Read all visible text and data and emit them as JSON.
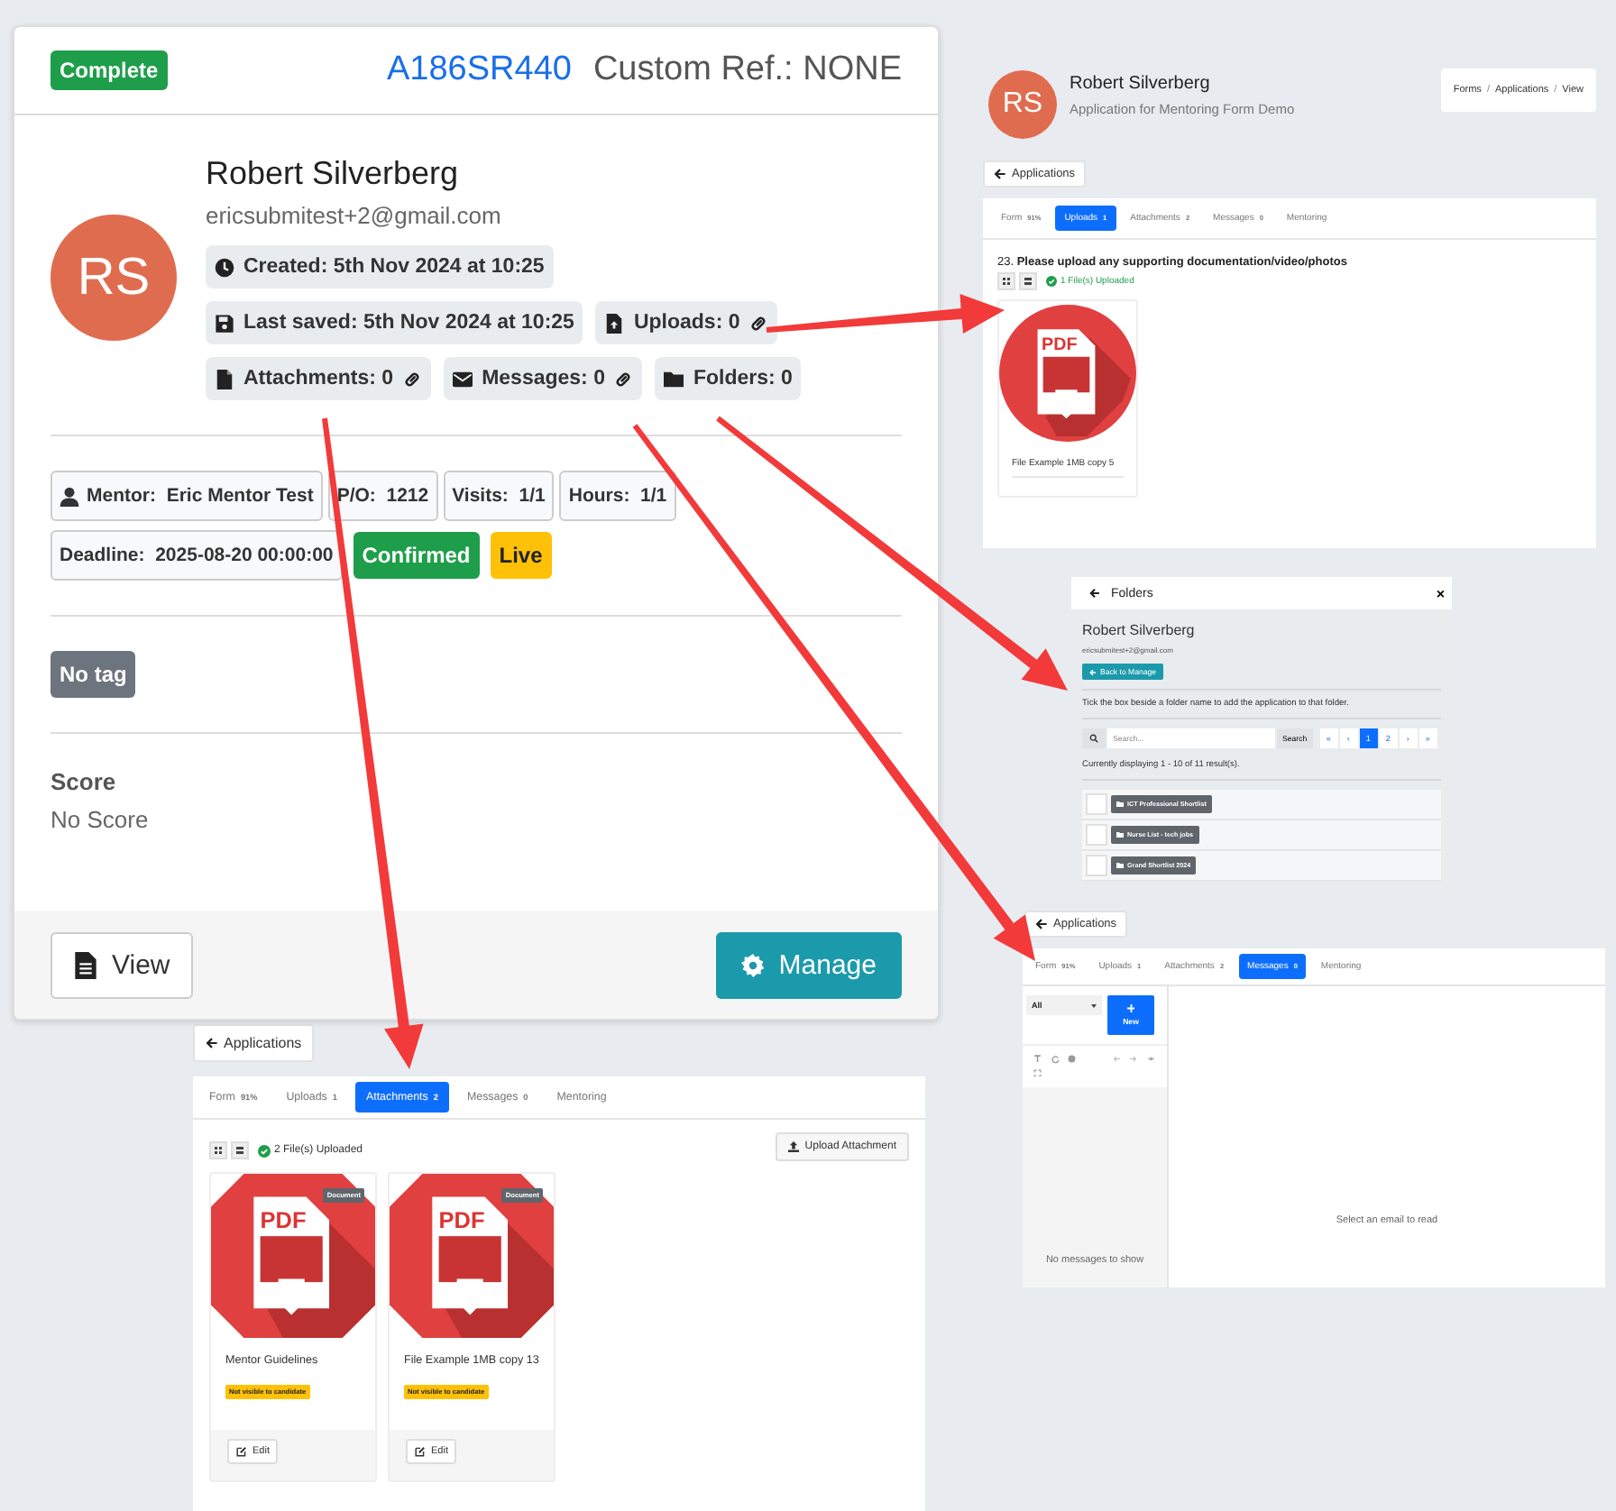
{
  "main_card": {
    "status_badge": "Complete",
    "reference": "A186SR440",
    "custom_ref": "Custom Ref.: NONE",
    "avatar_initials": "RS",
    "name": "Robert Silverberg",
    "email": "ericsubmitest+2@gmail.com",
    "info_rows": [
      {
        "chips": [
          {
            "kind": "created",
            "label": "Created: 5th Nov 2024 at 10:25",
            "link": false
          }
        ]
      },
      {
        "chips": [
          {
            "kind": "saved",
            "label": "Last saved: 5th Nov 2024 at 10:25",
            "link": false
          },
          {
            "kind": "uploads",
            "label": "Uploads: 0",
            "link": true
          }
        ]
      },
      {
        "chips": [
          {
            "kind": "attachments",
            "label": "Attachments: 0",
            "link": true
          },
          {
            "kind": "messages",
            "label": "Messages: 0",
            "link": true
          },
          {
            "kind": "folders",
            "label": "Folders: 0",
            "link": false
          }
        ]
      }
    ],
    "detail_rows": [
      {
        "items": [
          {
            "kind": "mentor",
            "label": "Mentor:",
            "value": "Eric Mentor Test"
          },
          {
            "kind": "field",
            "label": "P/O:",
            "value": "1212"
          },
          {
            "kind": "field",
            "label": "Visits:",
            "value": "1/1"
          },
          {
            "kind": "field",
            "label": "Hours:",
            "value": "1/1"
          }
        ]
      },
      {
        "items": [
          {
            "kind": "field",
            "label": "Deadline:",
            "value": "2025-08-20 00:00:00"
          },
          {
            "kind": "status",
            "label": "Confirmed",
            "color": "#1e9e4a"
          },
          {
            "kind": "status",
            "label": "Live",
            "color": "#ffc107"
          }
        ]
      }
    ],
    "tag": "No tag",
    "score_label": "Score",
    "score_value": "No Score",
    "actions": [
      {
        "kind": "view",
        "label": "View"
      },
      {
        "kind": "manage",
        "label": "Manage"
      }
    ]
  },
  "uploads_view": {
    "avatar_initials": "RS",
    "name": "Robert Silverberg",
    "subtitle": "Application for Mentoring Form Demo",
    "breadcrumb": [
      "Forms",
      "Applications",
      "View"
    ],
    "breadcrumb_separator": "/",
    "back_button": "Applications",
    "tabs": [
      {
        "label": "Form",
        "count": "91%",
        "selected": false
      },
      {
        "label": "Uploads",
        "count": "1",
        "selected": true
      },
      {
        "label": "Attachments",
        "count": "2",
        "selected": false
      },
      {
        "label": "Messages",
        "count": "0",
        "selected": false
      },
      {
        "label": "Mentoring",
        "selected": false
      }
    ],
    "question": "23. **Please upload any supporting documentation/video/photos**",
    "uploaded_count": "1 File(s) Uploaded",
    "files": [
      {
        "name": "File Example 1MB copy 5",
        "icon_label": "PDF"
      }
    ]
  },
  "folders_modal": {
    "title": "Folders",
    "close": "×",
    "name": "Robert Silverberg",
    "email": "ericsubmitest+2@gmail.com",
    "back_button": "Back to Manage",
    "instruction": "Tick the box beside a folder name to add the application to that folder.",
    "search": {
      "placeholder": "Search...",
      "button": "Search"
    },
    "pages": [
      {
        "label": "«",
        "selected": false
      },
      {
        "label": "‹",
        "selected": false
      },
      {
        "label": "1",
        "selected": true
      },
      {
        "label": "2",
        "selected": false
      },
      {
        "label": "›",
        "selected": false
      },
      {
        "label": "»",
        "selected": false
      }
    ],
    "result_summary": "Currently displaying 1 - 10 of 11 result(s).",
    "folders": [
      {
        "name": "ICT Professional Shortlist",
        "checked": false
      },
      {
        "name": "Nurse List - tech jobs",
        "checked": false
      },
      {
        "name": "Grand Shortlist 2024",
        "checked": false
      }
    ]
  },
  "messages_view": {
    "back_button": "Applications",
    "tabs": [
      {
        "label": "Form",
        "count": "91%",
        "selected": false
      },
      {
        "label": "Uploads",
        "count": "1",
        "selected": false
      },
      {
        "label": "Attachments",
        "count": "2",
        "selected": false
      },
      {
        "label": "Messages",
        "count": "0",
        "selected": true
      },
      {
        "label": "Mentoring",
        "selected": false
      }
    ],
    "filter": "All",
    "new_button": "New",
    "empty_list": "No messages to show",
    "empty_reader": "Select an email to read"
  },
  "attachments_view": {
    "back_button": "Applications",
    "tabs": [
      {
        "label": "Form",
        "count": "91%",
        "selected": false
      },
      {
        "label": "Uploads",
        "count": "1",
        "selected": false
      },
      {
        "label": "Attachments",
        "count": "2",
        "selected": true
      },
      {
        "label": "Messages",
        "count": "0",
        "selected": false
      },
      {
        "label": "Mentoring",
        "selected": false
      }
    ],
    "uploaded_count": "2 File(s) Uploaded",
    "upload_button": "Upload Attachment",
    "files": [
      {
        "name": "Mentor Guidelines",
        "icon_label": "PDF",
        "type_badge": "Document",
        "visibility": "Not visible to candidate",
        "edit_button": "Edit"
      },
      {
        "name": "File Example 1MB copy 13",
        "icon_label": "PDF",
        "type_badge": "Document",
        "visibility": "Not visible to candidate",
        "edit_button": "Edit"
      }
    ]
  }
}
